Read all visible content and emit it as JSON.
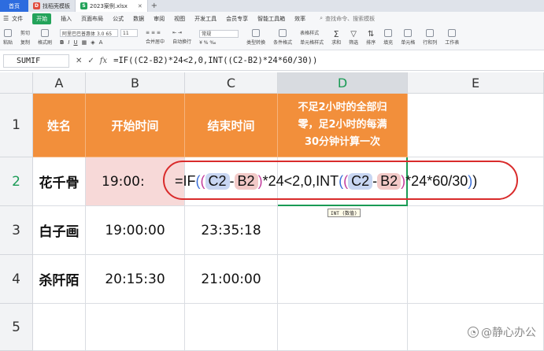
{
  "tabs": {
    "home": "首页",
    "doc1": {
      "label": "找稻壳模板",
      "badge": "D"
    },
    "doc2": {
      "label": "2023案例.xlsx",
      "badge": "S"
    }
  },
  "menu": {
    "file": "文件",
    "items": [
      "开始",
      "插入",
      "页面布局",
      "公式",
      "数据",
      "审阅",
      "视图",
      "开发工具",
      "会员专享",
      "智能工具箱",
      "效率"
    ],
    "search": "查找命令、搜索模板"
  },
  "ribbon": {
    "cut": "剪切",
    "copy": "复制",
    "format": "格式刷",
    "paste": "粘贴",
    "font": "阿里巴巴普惠体 3.0 65",
    "size": "11",
    "wrap": "合并居中",
    "autowrap": "自动换行",
    "currency": "常规",
    "type_convert": "类型转换",
    "cond_format": "条件格式",
    "table_style": "表格样式",
    "cell_style": "单元格样式",
    "sum": "求和",
    "filter": "筛选",
    "sort": "排序",
    "fill": "填充",
    "cells": "单元格",
    "rowcol": "行和列",
    "sheet": "工作表"
  },
  "formula_bar": {
    "name_box": "SUMIF",
    "cancel_icon": "✕",
    "confirm_icon": "✓",
    "fx": "fx",
    "formula": "=IF((C2-B2)*24<2,0,INT((C2-B2)*24*60/30))"
  },
  "columns": [
    "A",
    "B",
    "C",
    "D",
    "E"
  ],
  "rows": [
    "1",
    "2",
    "3",
    "4",
    "5"
  ],
  "header": {
    "a": "姓名",
    "b": "开始时间",
    "c": "结束时间",
    "d_line1": "不足2小时的全部归",
    "d_line2": "零，足2小时的每满",
    "d_line3": "30分钟计算一次"
  },
  "data": [
    {
      "name": "花千骨",
      "start": "19:00:",
      "end": ""
    },
    {
      "name": "白子画",
      "start": "19:00:00",
      "end": "23:35:18"
    },
    {
      "name": "杀阡陌",
      "start": "20:15:30",
      "end": "21:00:00"
    }
  ],
  "editing": {
    "eq": "=IF",
    "op1": "(",
    "op2": "(",
    "c2": "C2",
    "minus": "-",
    "b2": "B2",
    "cl1": ")",
    "mid": "*24<2,0,INT",
    "op3": "(",
    "op4": "(",
    "c2b": "C2",
    "minus2": "-",
    "b2b": "B2",
    "cl2": ")",
    "tail": "*24*60/30",
    "cl3": ")",
    "cl4": ")"
  },
  "tooltip": "INT (数值)",
  "watermark": "@静心办公",
  "colors": {
    "header_fill": "#f28f3b",
    "accent_green": "#1a9b55",
    "oval": "#d92b2b"
  }
}
